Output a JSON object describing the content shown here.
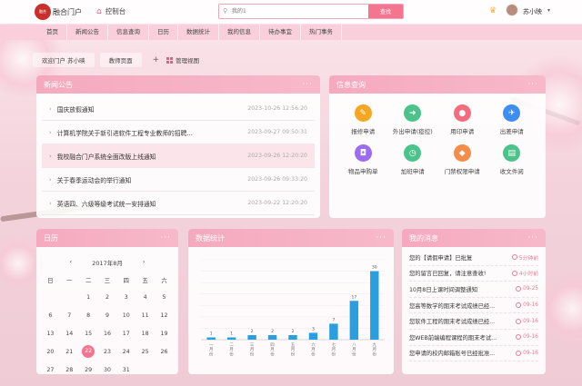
{
  "header": {
    "brand": "融合门户",
    "logo_text": "融合",
    "console": "控制台",
    "search_placeholder": "我的1",
    "search_button": "查找",
    "user": "苏小映"
  },
  "nav": [
    "首页",
    "新闻公告",
    "信息查询",
    "日历",
    "数据统计",
    "我的信息",
    "待办事宜",
    "热门事务"
  ],
  "tabs": {
    "welcome": "欢迎门户 苏小映",
    "teacher": "教师页面",
    "plus": "+",
    "manage": "管理视图"
  },
  "news": {
    "title": "新闻公告",
    "items": [
      {
        "title": "国庆放假通知",
        "date": "2023-10-26 12:56:20"
      },
      {
        "title": "计算机学院关于新引进软件工程专业教师的招聘...",
        "date": "2023-09-27 09:50:31"
      },
      {
        "title": "我校融合门户系统全面改版上线通知",
        "date": "2023-09-26 12:20:20"
      },
      {
        "title": "关于春季运动会的举行通知",
        "date": "2023-09-26 09:33:20"
      },
      {
        "title": "英语四、六级等级考试统一安排通知",
        "date": "2023-09-22 12:20:20"
      }
    ]
  },
  "info": {
    "title": "信息查询",
    "items": [
      {
        "label": "报修申请",
        "color": "#f5a623",
        "glyph": "✎"
      },
      {
        "label": "外出申请(疫控)",
        "color": "#4cc38a",
        "glyph": "➜"
      },
      {
        "label": "用印申请",
        "color": "#f56c7e",
        "glyph": "●"
      },
      {
        "label": "出差申请",
        "color": "#3d8ef0",
        "glyph": "✈"
      },
      {
        "label": "物品申购单",
        "color": "#9b6cf0",
        "glyph": "◘"
      },
      {
        "label": "加班申请",
        "color": "#4cc38a",
        "glyph": "◷"
      },
      {
        "label": "门禁权限申请",
        "color": "#f58c4a",
        "glyph": "◆"
      },
      {
        "label": "收文件阅",
        "color": "#4cc38a",
        "glyph": "▤"
      }
    ]
  },
  "calendar": {
    "title": "日历",
    "month": "2017年8月",
    "prev": "‹",
    "next": "›",
    "prev_year": "«",
    "next_year": "»",
    "weekdays": [
      "日",
      "一",
      "二",
      "三",
      "四",
      "五",
      "六"
    ],
    "weeks": [
      [
        "",
        "",
        "1",
        "2",
        "3",
        "4",
        "5"
      ],
      [
        "6",
        "7",
        "8",
        "9",
        "10",
        "11",
        "12"
      ],
      [
        "13",
        "14",
        "15",
        "16",
        "17",
        "18",
        "19"
      ],
      [
        "20",
        "21",
        "22",
        "23",
        "24",
        "25",
        "26"
      ],
      [
        "27",
        "28",
        "29",
        "30",
        "31",
        "",
        ""
      ]
    ],
    "today": "22"
  },
  "chart_title": "数据统计",
  "chart_data": {
    "type": "bar",
    "categories": [
      "一月份",
      "二月份",
      "三月份",
      "四月份",
      "五月份",
      "六月份",
      "七月份",
      "八月份",
      "九月份"
    ],
    "values": [
      1,
      1,
      2,
      2,
      2,
      3,
      7,
      17,
      30
    ],
    "ylim": [
      0,
      35
    ],
    "grid": true
  },
  "messages": {
    "title": "我的消息",
    "items": [
      {
        "text": "您的【请假申请】已批复",
        "time": "5分钟前"
      },
      {
        "text": "您的留言已回复，请注意查收!",
        "time": "4小时前"
      },
      {
        "text": "10月8日上课时间调整通知",
        "time": "09-25"
      },
      {
        "text": "您高等数学的期末考试成绩已经...",
        "time": "09-16"
      },
      {
        "text": "您软件工程的期末考试成绩已经...",
        "time": "09-16"
      },
      {
        "text": "您WEB前端编程课程的期末考试...",
        "time": "09-16"
      },
      {
        "text": "您申请的校内邮箱账号已经批准...",
        "time": "09-16"
      }
    ]
  }
}
